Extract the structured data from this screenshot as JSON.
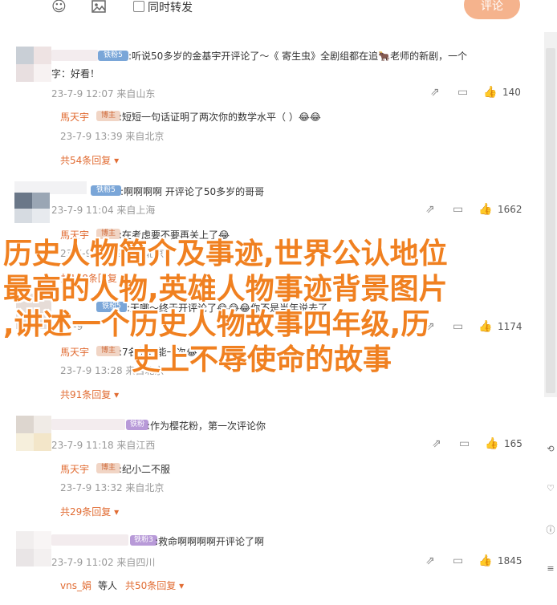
{
  "toolbar": {
    "emoji_icon": "smile-icon",
    "image_icon": "image-icon",
    "forward_label": "同时转发",
    "submit_label": "评论"
  },
  "colors": {
    "accent": "#e16c33",
    "submit_bg": "#f5b38d",
    "overlay_text": "#f08020"
  },
  "comments": [
    {
      "badge": "铁粉5",
      "text": ":听说50多岁的金基宇开评论了～《 寄生虫》全剧组都在追🐂老师的新剧，一个",
      "text2": "字：好看！",
      "meta": "23-7-9 12:07 来自山东",
      "likes": "140",
      "reply": {
        "name": "馬天宇",
        "badge": "博主",
        "text": ":短短一句话证明了两次你的数学水平（     ）😂😂",
        "meta": "23-7-9 13:39 来自北京"
      },
      "more": "共54条回复"
    },
    {
      "badge": "铁粉5",
      "text": ":啊啊啊啊 开评论了50多岁的哥哥",
      "meta": "23-7-9 11:04 来自上海",
      "likes": "1662",
      "reply": {
        "name": "馬天宇",
        "badge": "博主",
        "text": ":在考虑要不要再关上了😂",
        "meta": "23-7-9 13:39 来自北京"
      },
      "more": "共178条回复"
    },
    {
      "badge": "铁粉5",
      "text": ":天哪～终于开评论了😂😂😂你不是当年说去了",
      "meta": "23-7-9",
      "likes": "1174",
      "reply": {
        "name": "馬天宇",
        "badge": "博主",
        "text": ":7名的，能一次😂",
        "meta": "23-7-9 13:28 来自北京"
      },
      "more": "共91条回复"
    },
    {
      "badge": "铁粉3",
      "text": ":作为樱花粉，第一次评论你",
      "meta": "23-7-9 11:18 来自江西",
      "likes": "165",
      "reply": {
        "name": "馬天宇",
        "badge": "博主",
        "text": ":纪小二不服",
        "meta": "23-7-9 13:32 来自北京"
      },
      "more": "共29条回复"
    },
    {
      "badge": "铁粉3",
      "text": ":救命啊啊啊啊开评论了啊",
      "meta": "23-7-9 11:02 来自四川",
      "likes": "1845",
      "reply": {
        "name": "vns_娟",
        "badge": "",
        "text": "等人",
        "meta": ""
      },
      "more": "共50条回复"
    }
  ],
  "overlay": {
    "line1": "历史人物简介及事迹,世界公认地位",
    "line2": "最高的人物,英雄人物事迹背景图片",
    "line3": ",讲述一个历史人物故事四年级,历",
    "line4": "史上不辱使命的故事"
  },
  "side": {
    "icon1": "refresh-icon",
    "icon2": "heart-icon",
    "icon3": "info-icon",
    "icon4": "menu-icon"
  }
}
